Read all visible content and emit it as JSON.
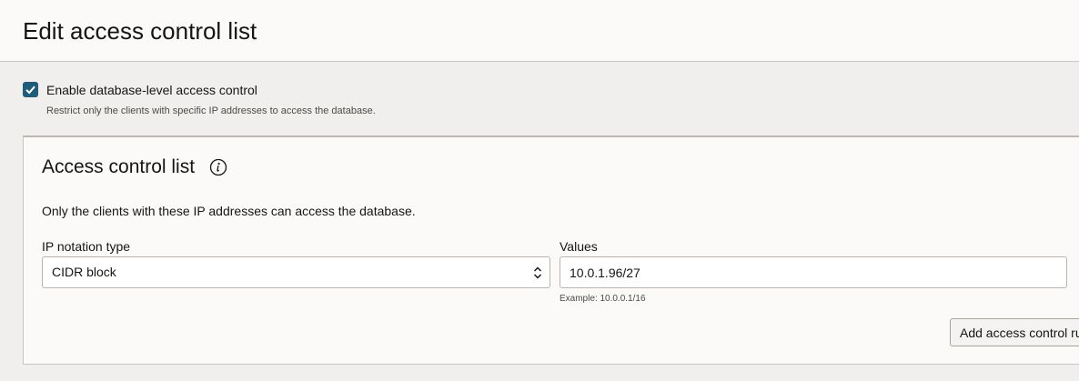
{
  "header": {
    "title": "Edit access control list"
  },
  "enable_access_control": {
    "checked": true,
    "label": "Enable database-level access control",
    "help": "Restrict only the clients with specific IP addresses to access the database."
  },
  "acl_panel": {
    "title": "Access control list",
    "info_icon": "info-icon",
    "description": "Only the clients with these IP addresses can access the database.",
    "ip_notation": {
      "label": "IP notation type",
      "value": "CIDR block"
    },
    "values": {
      "label": "Values",
      "value": "10.0.1.96/27",
      "hint": "Example: 10.0.0.1/16"
    },
    "add_button_label": "Add access control rule"
  },
  "colors": {
    "checkbox": "#1f5c7a",
    "background": "#f1efed",
    "panel": "#fbfaf8"
  }
}
